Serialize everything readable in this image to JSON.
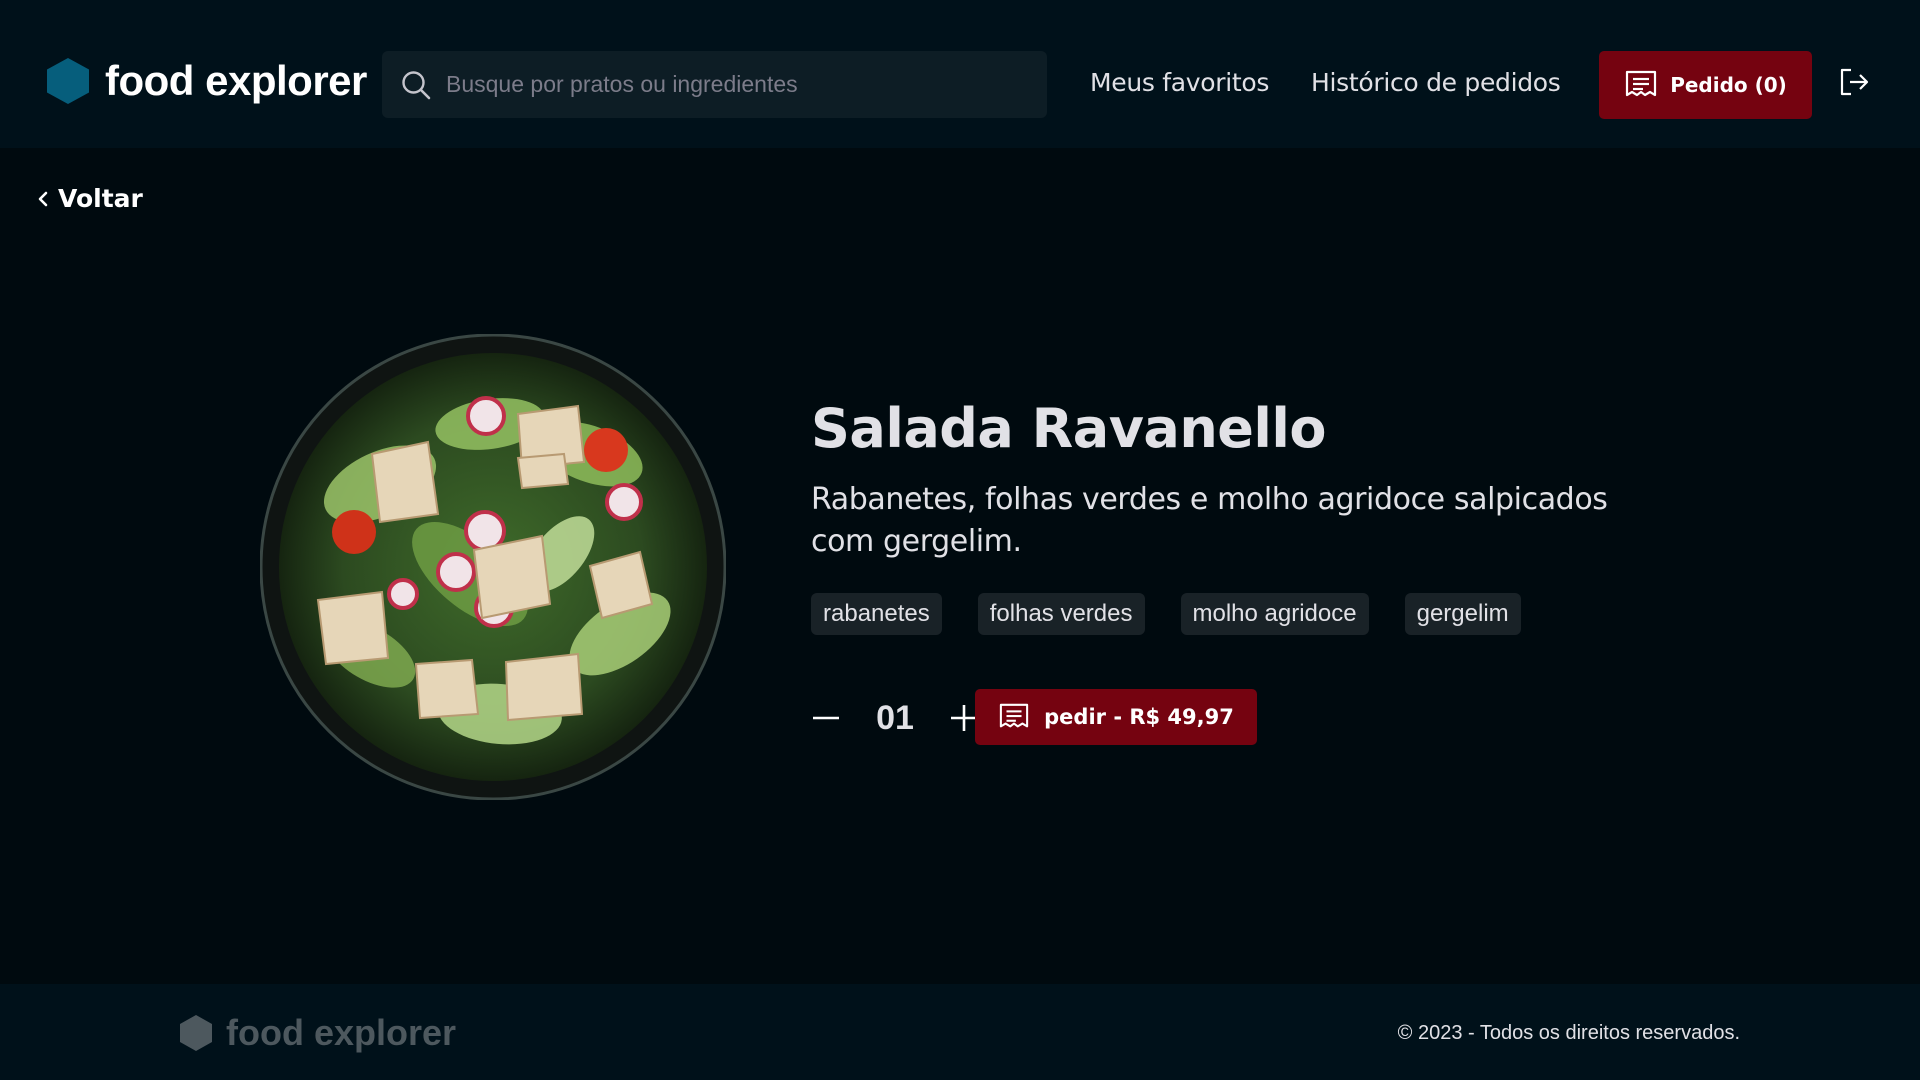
{
  "header": {
    "logo_text": "food explorer",
    "search_placeholder": "Busque por pratos ou ingredientes",
    "nav": {
      "favorites": "Meus favoritos",
      "history": "Histórico de pedidos"
    },
    "order_button": "Pedido (0)",
    "logout_icon": "sign-out-icon"
  },
  "back": {
    "label": "Voltar"
  },
  "dish": {
    "title": "Salada Ravanello",
    "description": "Rabanetes, folhas verdes e molho agridoce salpicados com gergelim.",
    "ingredients": [
      "rabanetes",
      "folhas verdes",
      "molho agridoce",
      "gergelim"
    ],
    "quantity": "01",
    "buy_button": "pedir - R$ 49,97"
  },
  "footer": {
    "logo_text": "food explorer",
    "copyright": "© 2023 - Todos os direitos reservados."
  },
  "colors": {
    "background": "#000a0f",
    "header": "#00111a",
    "accent": "#750310",
    "logo": "#065e7c",
    "tag": "#192227",
    "footer_logo": "#4d585e"
  }
}
